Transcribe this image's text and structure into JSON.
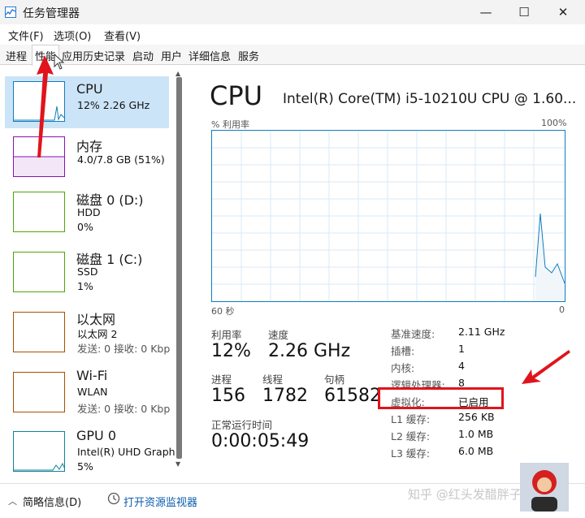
{
  "window": {
    "title": "任务管理器",
    "min": "—",
    "max": "☐",
    "close": "✕"
  },
  "menu": [
    "文件(F)",
    "选项(O)",
    "查看(V)"
  ],
  "tabs": [
    "进程",
    "性能",
    "应用历史记录",
    "启动",
    "用户",
    "详细信息",
    "服务"
  ],
  "resources": [
    {
      "title": "CPU",
      "line1": "12% 2.26 GHz",
      "line2": "",
      "color": "#117dbb"
    },
    {
      "title": "内存",
      "line1": "4.0/7.8 GB (51%)",
      "line2": "",
      "color": "#8b12ae"
    },
    {
      "title": "磁盘 0 (D:)",
      "line1": "HDD",
      "line2": "0%",
      "color": "#4da60c"
    },
    {
      "title": "磁盘 1 (C:)",
      "line1": "SSD",
      "line2": "1%",
      "color": "#4da60c"
    },
    {
      "title": "以太网",
      "line1": "以太网 2",
      "line2": "发送: 0 接收: 0 Kbp",
      "color": "#a74f01"
    },
    {
      "title": "Wi-Fi",
      "line1": "WLAN",
      "line2": "发送: 0 接收: 0 Kbp",
      "color": "#a74f01"
    },
    {
      "title": "GPU 0",
      "line1": "Intel(R) UHD Graph",
      "line2": "5%",
      "color": "#0f8296"
    }
  ],
  "detail": {
    "title": "CPU",
    "model": "Intel(R) Core(TM) i5-10210U CPU @ 1.60...",
    "graph_label_left": "% 利用率",
    "graph_label_right": "100%",
    "axis_left": "60 秒",
    "axis_right": "0",
    "stats": {
      "util_label": "利用率",
      "util_value": "12%",
      "speed_label": "速度",
      "speed_value": "2.26 GHz",
      "proc_label": "进程",
      "proc_value": "156",
      "thread_label": "线程",
      "thread_value": "1782",
      "handle_label": "句柄",
      "handle_value": "61582",
      "uptime_label": "正常运行时间",
      "uptime_value": "0:00:05:49"
    },
    "specs": [
      {
        "label": "基准速度:",
        "value": "2.11 GHz"
      },
      {
        "label": "插槽:",
        "value": "1"
      },
      {
        "label": "内核:",
        "value": "4"
      },
      {
        "label": "逻辑处理器:",
        "value": "8"
      },
      {
        "label": "虚拟化:",
        "value": "已启用"
      },
      {
        "label": "L1 缓存:",
        "value": "256 KB"
      },
      {
        "label": "L2 缓存:",
        "value": "1.0 MB"
      },
      {
        "label": "L3 缓存:",
        "value": "6.0 MB"
      }
    ]
  },
  "footer": {
    "less": "简略信息(D)",
    "open": "打开资源监视器"
  },
  "watermark": "知乎 @红头发醋胖子",
  "colors": {
    "annotation": "#e0141c",
    "cpu_graph": "#117dbb",
    "selection": "#cce4f7"
  }
}
